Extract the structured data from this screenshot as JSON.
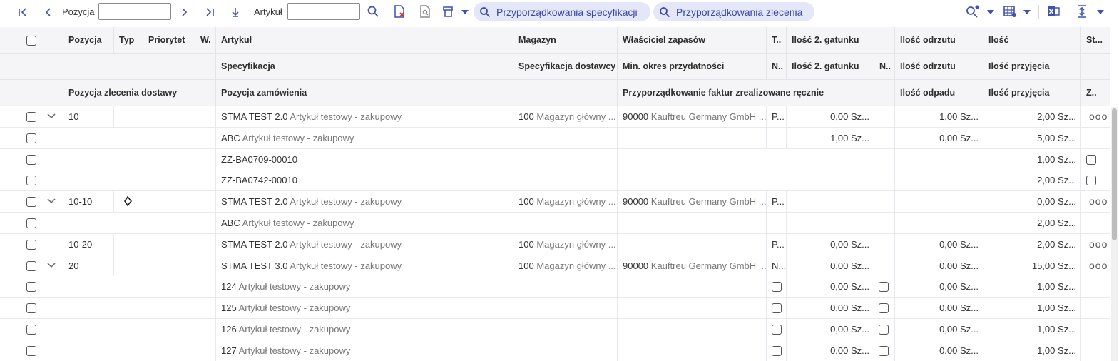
{
  "toolbar": {
    "position_label": "Pozycja",
    "position_value": "",
    "article_label": "Artykuł",
    "article_value": "",
    "pill_spec": "Przyporządkowania specyfikacji",
    "pill_order": "Przyporządkowania zlecenia",
    "icons": [
      "first-page-icon",
      "prev-icon",
      "next-icon",
      "last-page-icon",
      "down-arrow-icon",
      "search-icon",
      "clear-filter-icon",
      "find-doc-icon",
      "print-icon",
      "query-settings-icon",
      "layout-icon",
      "excel-icon",
      "align-icon"
    ]
  },
  "headers": {
    "row1": {
      "pozycja": "Pozycja",
      "typ": "Typ",
      "priorytet": "Priorytet",
      "w": "W.",
      "artykul": "Artykuł",
      "magazyn": "Magazyn",
      "wlasciciel": "Właściciel zapasów",
      "t": "T..",
      "ilosc2": "Ilość 2. gatunku",
      "odrzutu": "Ilość odrzutu",
      "ilosc": "Ilość",
      "st": "St..."
    },
    "row2": {
      "specyfikacja": "Specyfikacja",
      "spec_dost": "Specyfikacja dostawcy",
      "min_okres": "Min. okres przydatności",
      "n1": "N..",
      "ilosc2": "Ilość 2. gatunku",
      "n2": "N..",
      "odrzutu": "Ilość odrzutu",
      "przyjecia": "Ilość przyjęcia"
    },
    "row3": {
      "poz_zlec": "Pozycja zlecenia dostawy",
      "poz_zam": "Pozycja zamówienia",
      "przyporz": "Przyporządkowanie faktur zrealizowane ręcznie",
      "odpadu": "Ilość odpadu",
      "przyjecia": "Ilość przyjęcia",
      "z": "Z.."
    }
  },
  "rows": [
    {
      "type": "main",
      "expand": true,
      "pos": "10",
      "typ_icon": "",
      "art_code": "STMA TEST 2.0",
      "art_desc": "Artykuł testowy - zakupowy",
      "mag_code": "100",
      "mag_desc": "Magazyn główny ...",
      "own_code": "90000",
      "own_desc": "Kauftreu Germany GmbH ...",
      "t": "P...",
      "q2": "0,00 Sz...",
      "odrz": "1,00 Sz...",
      "ilosc": "2,00 Sz...",
      "more": "ooo"
    },
    {
      "type": "spec",
      "art_code": "ABC",
      "art_desc": "Artykuł testowy - zakupowy",
      "q2": "1,00 Sz...",
      "odrz": "0,00 Sz...",
      "ilosc": "5,00 Sz..."
    },
    {
      "type": "order",
      "code": "ZZ-BA0709-00010",
      "ilosc": "1,00 Sz...",
      "zchk": true
    },
    {
      "type": "order",
      "code": "ZZ-BA0742-00010",
      "ilosc": "2,00 Sz...",
      "zchk": true
    },
    {
      "type": "main",
      "expand": true,
      "pos": "10-10",
      "typ_icon": "diamond-icon",
      "art_code": "STMA TEST 2.0",
      "art_desc": "Artykuł testowy - zakupowy",
      "mag_code": "100",
      "mag_desc": "Magazyn główny ...",
      "own_code": "90000",
      "own_desc": "Kauftreu Germany GmbH ...",
      "t": "P...",
      "q2": "",
      "odrz": "",
      "ilosc": "0,00 Sz...",
      "more": "ooo"
    },
    {
      "type": "spec",
      "art_code": "ABC",
      "art_desc": "Artykuł testowy - zakupowy",
      "q2": "",
      "odrz": "",
      "ilosc": "2,00 Sz..."
    },
    {
      "type": "main",
      "expand": false,
      "pos": "10-20",
      "typ_icon": "",
      "art_code": "STMA TEST 2.0",
      "art_desc": "Artykuł testowy - zakupowy",
      "mag_code": "100",
      "mag_desc": "Magazyn główny ...",
      "own_code": "",
      "own_desc": "",
      "t": "P...",
      "q2": "0,00 Sz...",
      "odrz": "0,00 Sz...",
      "ilosc": "2,00 Sz...",
      "more": "ooo"
    },
    {
      "type": "main",
      "expand": true,
      "pos": "20",
      "typ_icon": "",
      "art_code": "STMA TEST 3.0",
      "art_desc": "Artykuł testowy - zakupowy",
      "mag_code": "100",
      "mag_desc": "Magazyn główny ...",
      "own_code": "90000",
      "own_desc": "Kauftreu Germany GmbH ...",
      "t": "N...",
      "q2": "0,00 Sz...",
      "odrz": "0,00 Sz...",
      "ilosc": "15,00 Sz...",
      "more": "ooo"
    },
    {
      "type": "spec2",
      "art_code": "124",
      "art_desc": "Artykuł testowy - zakupowy",
      "q2": "0,00 Sz...",
      "odrz": "0,00 Sz...",
      "ilosc": "1,00 Sz..."
    },
    {
      "type": "spec2",
      "art_code": "125",
      "art_desc": "Artykuł testowy - zakupowy",
      "q2": "0,00 Sz...",
      "odrz": "0,00 Sz...",
      "ilosc": "1,00 Sz..."
    },
    {
      "type": "spec2",
      "art_code": "126",
      "art_desc": "Artykuł testowy - zakupowy",
      "q2": "0,00 Sz...",
      "odrz": "0,00 Sz...",
      "ilosc": "1,00 Sz..."
    },
    {
      "type": "spec2",
      "art_code": "127",
      "art_desc": "Artykuł testowy - zakupowy",
      "q2": "0,00 Sz...",
      "odrz": "0,00 Sz...",
      "ilosc": "1,00 Sz..."
    }
  ],
  "colors": {
    "accent": "#3f51b5",
    "pill_bg": "#e4e7f7",
    "header_bg": "#f5f5f7"
  }
}
